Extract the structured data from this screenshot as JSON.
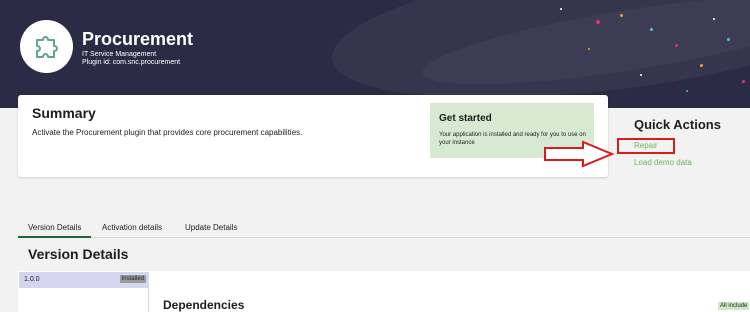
{
  "plugin": {
    "title": "Procurement",
    "category": "IT Service Management",
    "plugin_id": "Plugin id: com.snc.procurement",
    "logo_icon": "puzzle-piece-icon"
  },
  "summary": {
    "title": "Summary",
    "description": "Activate the Procurement plugin that provides core procurement capabilities."
  },
  "get_started": {
    "title": "Get started",
    "description": "Your application is installed and ready for you to use on your instance"
  },
  "quick_actions": {
    "title": "Quick Actions",
    "repair": "Repair",
    "load_demo": "Load demo data"
  },
  "tabs": [
    {
      "label": "Version Details",
      "active": true
    },
    {
      "label": "Activation details",
      "active": false
    },
    {
      "label": "Update Details",
      "active": false
    }
  ],
  "version_details": {
    "title": "Version Details",
    "versions": [
      {
        "number": "1.0.0",
        "status": "Installed"
      }
    ],
    "dependencies_title": "Dependencies",
    "dependencies_badge": "All include"
  },
  "colors": {
    "hero": "#2b2b45",
    "accent_green": "#72b35a",
    "annotation_red": "#d81c1c"
  }
}
